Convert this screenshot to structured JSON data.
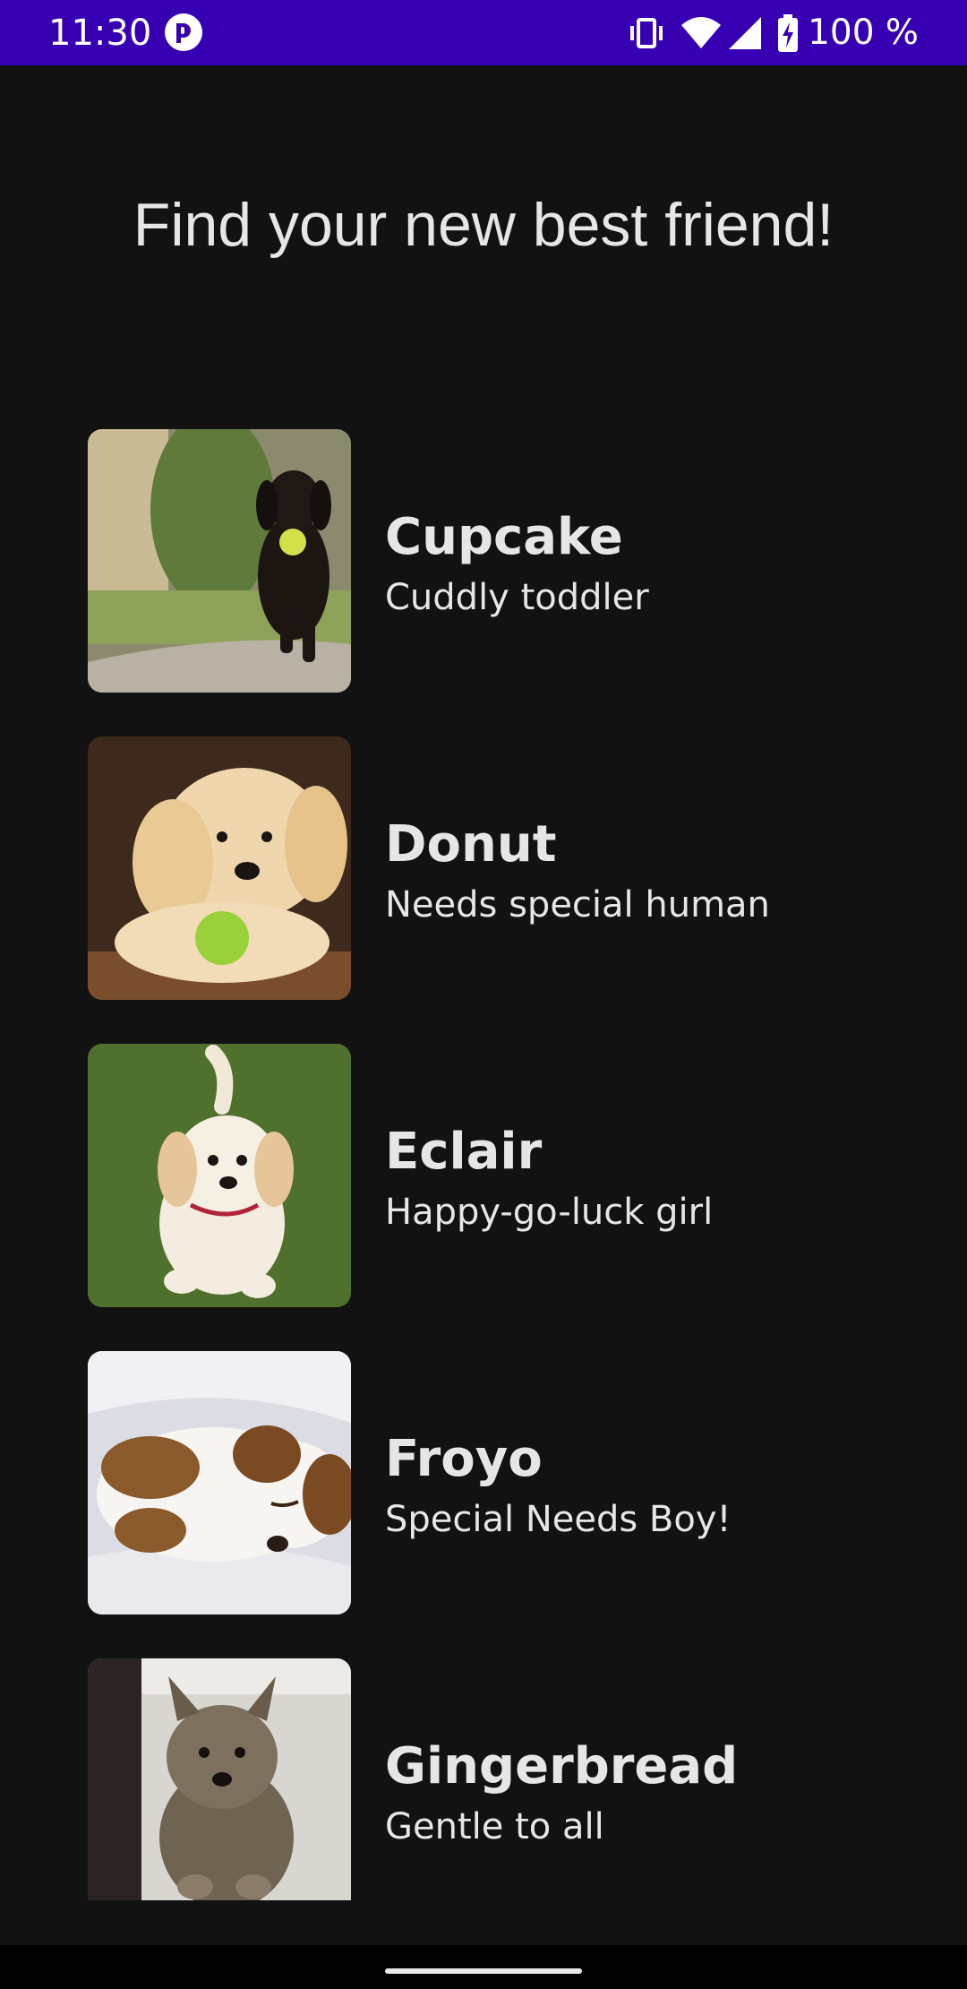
{
  "status_bar": {
    "time": "11:30",
    "battery": "100 %",
    "icons": [
      "app-notification-icon",
      "vibrate-icon",
      "wifi-icon",
      "signal-icon",
      "battery-charging-icon"
    ],
    "background": "#3700b3"
  },
  "title": "Find your new best friend!",
  "pets": [
    {
      "name": "Cupcake",
      "description": "Cuddly toddler",
      "photo": "black-dachshund-puppy-with-ball"
    },
    {
      "name": "Donut",
      "description": "Needs special human",
      "photo": "golden-retriever-puppy-with-green-ball"
    },
    {
      "name": "Eclair",
      "description": "Happy-go-luck girl",
      "photo": "cream-puppy-on-grass"
    },
    {
      "name": "Froyo",
      "description": "Special Needs Boy!",
      "photo": "sleeping-white-brown-puppy"
    },
    {
      "name": "Gingerbread",
      "description": "Gentle to all",
      "photo": "scruffy-terrier-puppy"
    }
  ],
  "colors": {
    "background": "#121212",
    "text": "#e6e6e6",
    "accent": "#3700b3"
  }
}
